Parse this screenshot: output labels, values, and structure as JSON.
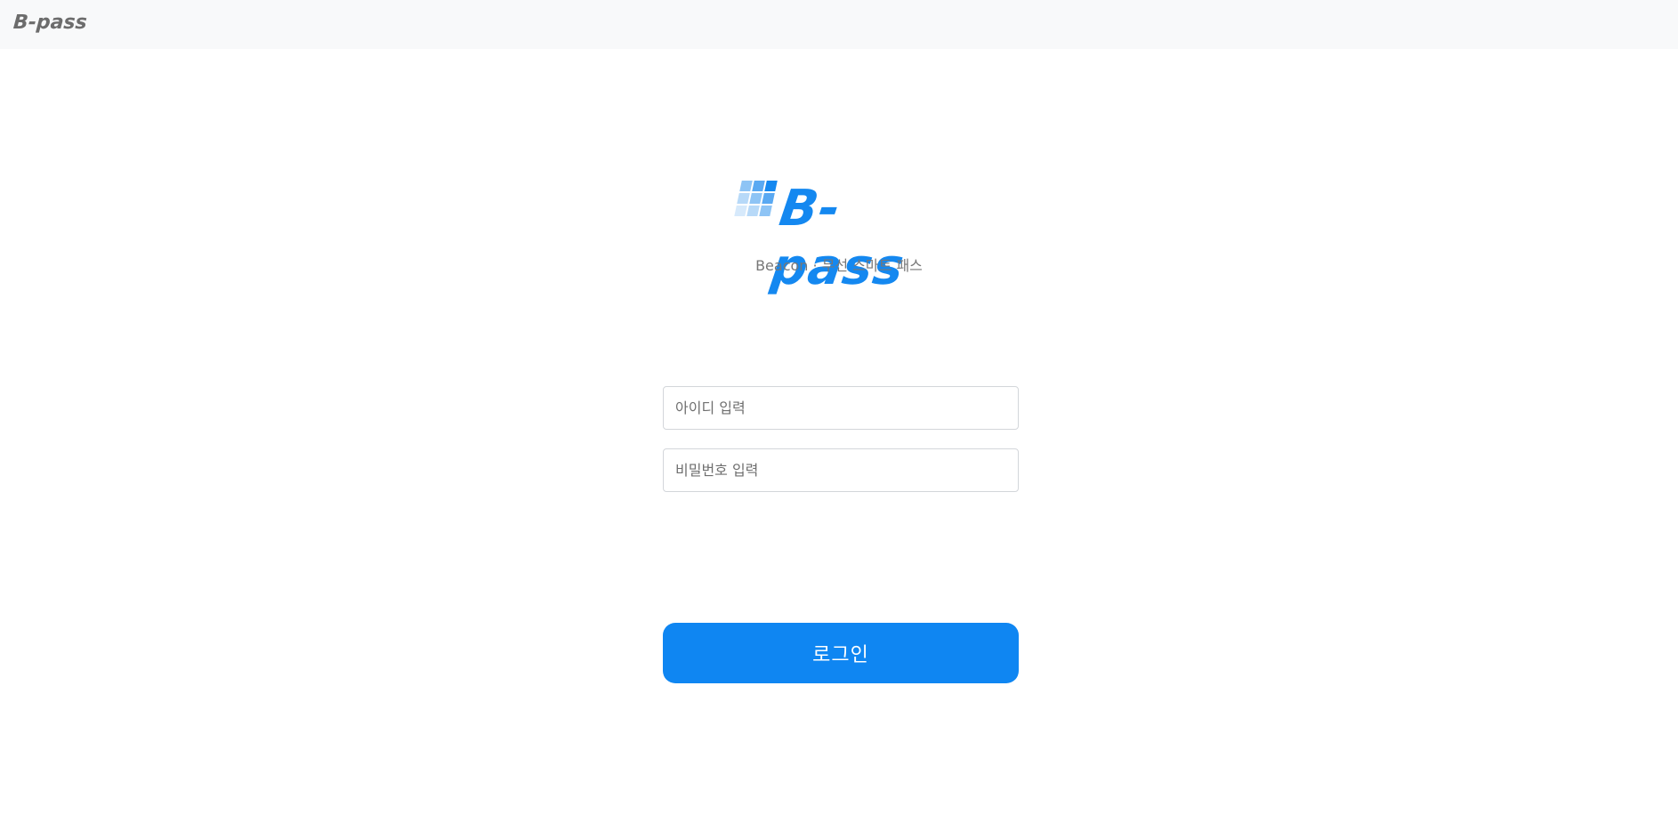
{
  "header": {
    "brand": "B-pass"
  },
  "logo": {
    "text": "B-pass",
    "subtitle": "Beacon · 무선 스마트 패스"
  },
  "form": {
    "id_placeholder": "아이디 입력",
    "id_value": "",
    "password_placeholder": "비밀번호 입력",
    "password_value": "",
    "login_label": "로그인"
  },
  "colors": {
    "accent": "#0f86f2",
    "topbar_bg": "#f8f9fa",
    "brand_gray": "#6c6c6c"
  }
}
